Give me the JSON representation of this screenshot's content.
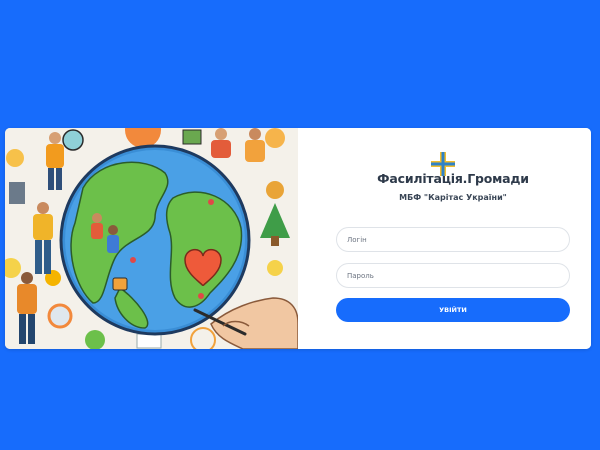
{
  "colors": {
    "page_background": "#176cfc",
    "card_background": "#ffffff",
    "button_background": "#176cfc",
    "logo_cross_yellow": "#f2bd2e",
    "logo_cross_blue": "#2f82c8"
  },
  "illustration": {
    "description_icon": "globe-community-illustration"
  },
  "brand": {
    "logo_icon": "caritas-cross-icon",
    "title": "Фасилітація.Громади",
    "subtitle": "МБФ \"Карітас України\""
  },
  "form": {
    "login_placeholder": "Логін",
    "password_placeholder": "Пароль",
    "submit_label": "УВІЙТИ"
  }
}
